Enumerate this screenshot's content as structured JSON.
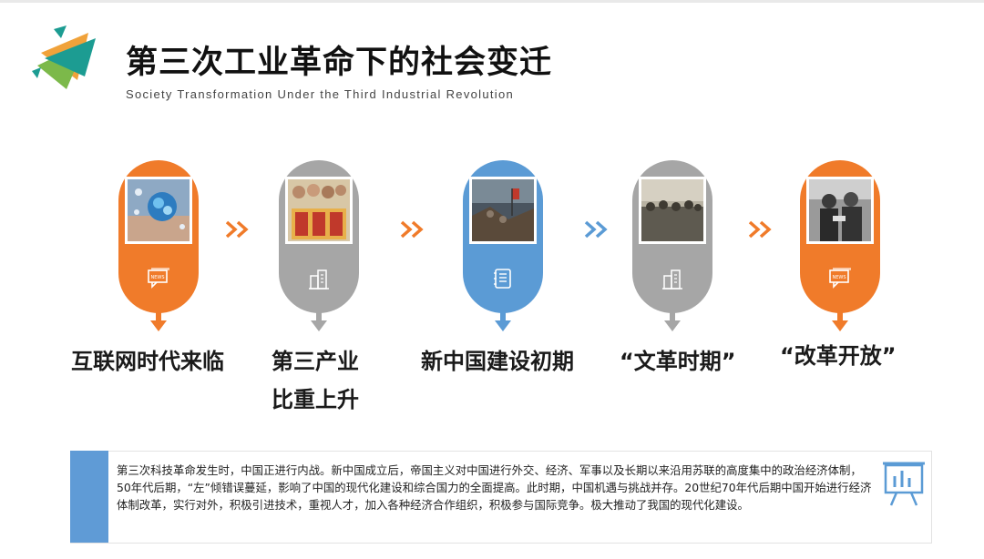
{
  "header": {
    "title": "第三次工业革命下的社会变迁",
    "subtitle": "Society Transformation Under the Third Industrial Revolution"
  },
  "colors": {
    "orange": "#f07b2a",
    "gray": "#a6a6a6",
    "blue": "#5b9bd5",
    "chevron_orange": "#f07b2a",
    "chevron_blue": "#5b9bd5"
  },
  "timeline": {
    "stages": [
      {
        "label": "互联网时代来临",
        "label2": "",
        "color": "orange",
        "icon": "news-icon",
        "photo": "globe-in-hand-photo"
      },
      {
        "label": "第三产业",
        "label2": "比重上升",
        "color": "gray",
        "icon": "buildings-icon",
        "photo": "service-industry-poster-photo"
      },
      {
        "label": "新中国建设初期",
        "label2": "",
        "color": "blue",
        "icon": "notebook-icon",
        "photo": "battle-painting-photo"
      },
      {
        "label": "“文革时期”",
        "label2": "",
        "color": "gray",
        "icon": "buildings-icon",
        "photo": "crowd-rally-photo"
      },
      {
        "label": "“改革开放”",
        "label2": "",
        "color": "orange",
        "icon": "news-icon",
        "photo": "leaders-meeting-photo"
      }
    ]
  },
  "info": {
    "text": "第三次科技革命发生时，中国正进行内战。新中国成立后，帝国主义对中国进行外交、经济、军事以及长期以来沿用苏联的高度集中的政治经济体制，50年代后期，“左”倾错误蔓延，影响了中国的现代化建设和综合国力的全面提高。此时期，中国机遇与挑战并存。20世纪70年代后期中国开始进行经济体制改革，实行对外，积极引进技术，重视人才，加入各种经济合作组织，积极参与国际竞争。极大推动了我国的现代化建设。",
    "icon": "presentation-chart-icon"
  }
}
